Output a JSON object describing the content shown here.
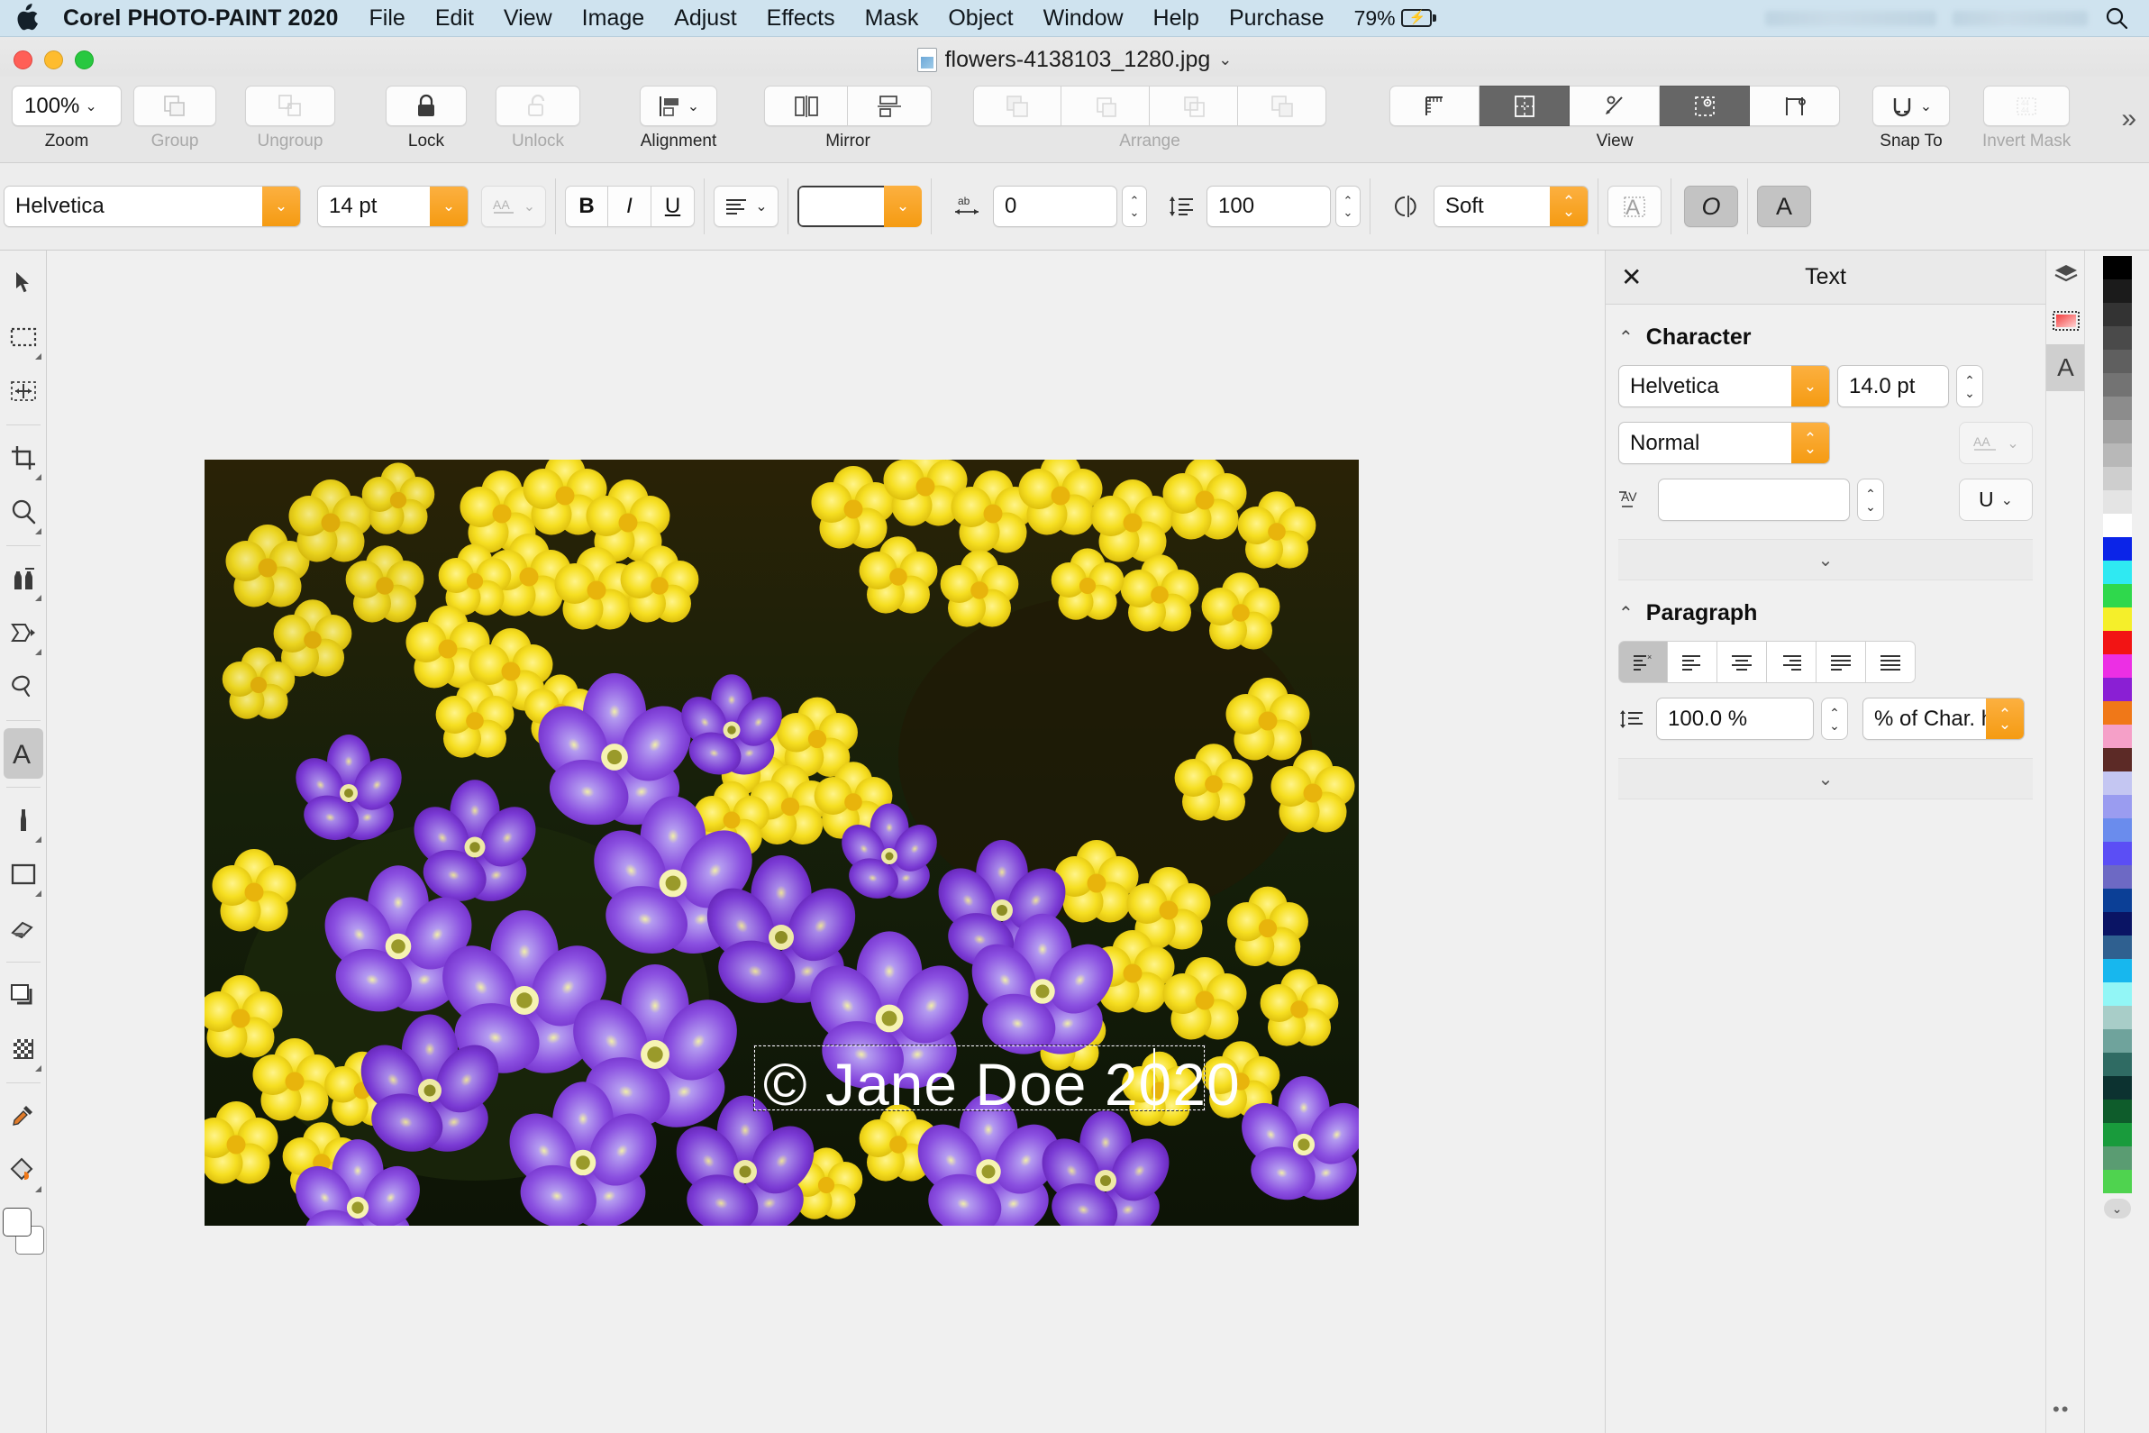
{
  "menubar": {
    "app_name": "Corel PHOTO-PAINT 2020",
    "items": [
      "File",
      "Edit",
      "View",
      "Image",
      "Adjust",
      "Effects",
      "Mask",
      "Object",
      "Window",
      "Help",
      "Purchase"
    ],
    "battery_pct": "79%",
    "battery_icon": "battery-charging-icon",
    "search_icon": "search-icon",
    "apple_icon": "apple-logo-icon"
  },
  "titlebar": {
    "filename": "flowers-4138103_1280.jpg",
    "chevron": "⌄",
    "doc_icon": "jpeg-document-icon"
  },
  "command_toolbar": {
    "zoom": {
      "value": "100%",
      "label": "Zoom",
      "chevron": "⌄"
    },
    "groups": [
      {
        "label": "Group",
        "enabled": false,
        "icon": "group-objects-icon"
      },
      {
        "label": "Ungroup",
        "enabled": false,
        "icon": "ungroup-objects-icon"
      },
      {
        "label": "Lock",
        "enabled": true,
        "icon": "lock-closed-icon"
      },
      {
        "label": "Unlock",
        "enabled": false,
        "icon": "lock-open-icon"
      }
    ],
    "alignment": {
      "label": "Alignment",
      "icon": "align-objects-icon",
      "chevron": "⌄"
    },
    "mirror": {
      "label": "Mirror",
      "icons": [
        "mirror-horizontal-icon",
        "mirror-vertical-icon"
      ]
    },
    "arrange": {
      "label": "Arrange",
      "icons": [
        "bring-to-front-icon",
        "bring-forward-icon",
        "send-backward-icon",
        "send-to-back-icon"
      ],
      "enabled": false
    },
    "view": {
      "label": "View",
      "buttons": [
        {
          "icon": "rulers-icon",
          "active": false
        },
        {
          "icon": "grid-icon",
          "active": true
        },
        {
          "icon": "guidelines-icon",
          "active": false
        },
        {
          "icon": "snap-guides-icon",
          "active": true
        },
        {
          "icon": "dynamic-guides-icon",
          "active": false
        }
      ]
    },
    "snap_to": {
      "label": "Snap To",
      "icon": "magnet-icon",
      "chevron": "⌄"
    },
    "invert_mask": {
      "label": "Invert Mask",
      "icon": "invert-mask-icon",
      "enabled": false
    },
    "overflow": "»"
  },
  "text_toolbar": {
    "font_family": "Helvetica",
    "font_size": "14 pt",
    "case_icon": "change-case-icon",
    "bold": "B",
    "italic": "I",
    "underline": "U",
    "align_icon": "text-align-icon",
    "color_swatch": "#ffffff",
    "tracking_icon": "character-spacing-icon",
    "tracking_value": "0",
    "leading_icon": "line-spacing-icon",
    "leading_value": "100",
    "smoothing_icon": "anti-alias-icon",
    "smoothing_value": "Soft",
    "buttons": [
      {
        "icon": "text-to-mask-icon",
        "pressed": false
      },
      {
        "icon": "wrap-text-icon",
        "pressed": true
      },
      {
        "icon": "text-options-icon",
        "pressed": true
      }
    ]
  },
  "toolbox": {
    "tools": [
      {
        "name": "pick-tool",
        "selected": false,
        "flyout": false
      },
      {
        "name": "rectangle-mask-tool",
        "selected": false,
        "flyout": true
      },
      {
        "name": "mask-transform-tool",
        "selected": false,
        "flyout": false
      },
      {
        "name": "crop-tool",
        "selected": false,
        "flyout": true
      },
      {
        "name": "zoom-tool",
        "selected": false,
        "flyout": true
      },
      {
        "name": "clone-tool",
        "selected": false,
        "flyout": true
      },
      {
        "name": "smear-tool",
        "selected": false,
        "flyout": true
      },
      {
        "name": "sharpen-tool",
        "selected": false,
        "flyout": false
      },
      {
        "name": "text-tool",
        "selected": true,
        "flyout": false
      },
      {
        "name": "paint-tool",
        "selected": false,
        "flyout": true
      },
      {
        "name": "rectangle-shape-tool",
        "selected": false,
        "flyout": true
      },
      {
        "name": "eraser-tool",
        "selected": false,
        "flyout": false
      },
      {
        "name": "object-transparency-tool",
        "selected": false,
        "flyout": false
      },
      {
        "name": "fill-tool",
        "selected": false,
        "flyout": true
      },
      {
        "name": "eyedropper-tool",
        "selected": false,
        "flyout": false
      },
      {
        "name": "interactive-fill-tool",
        "selected": false,
        "flyout": true
      }
    ],
    "foreground_color": "#ffffff",
    "background_color": "#ffffff"
  },
  "canvas": {
    "overlay_text": "© Jane Doe 2020",
    "selection": "text-object-selected"
  },
  "docker": {
    "title": "Text",
    "close_icon": "close-icon",
    "character": {
      "heading": "Character",
      "caret": "⌃",
      "font_family": "Helvetica",
      "font_size": "14.0 pt",
      "font_style": "Normal",
      "case_icon": "change-case-icon",
      "kerning_icon": "kerning-icon",
      "kerning_value": "",
      "underline_label": "U",
      "expand_caret": "⌄"
    },
    "paragraph": {
      "heading": "Paragraph",
      "caret": "⌃",
      "align_buttons": [
        {
          "icon": "align-none-icon",
          "active": true
        },
        {
          "icon": "align-left-icon",
          "active": false
        },
        {
          "icon": "align-center-icon",
          "active": false
        },
        {
          "icon": "align-right-icon",
          "active": false
        },
        {
          "icon": "align-justify-icon",
          "active": false
        },
        {
          "icon": "align-force-justify-icon",
          "active": false
        }
      ],
      "line_spacing_icon": "line-spacing-icon",
      "line_spacing_value": "100.0 %",
      "line_spacing_unit": "% of Char. heig...",
      "expand_caret": "⌄"
    }
  },
  "docker_rail": {
    "buttons": [
      {
        "icon": "objects-docker-icon",
        "active": false
      },
      {
        "icon": "color-docker-icon",
        "active": false
      },
      {
        "icon": "text-docker-icon",
        "active": true
      }
    ]
  },
  "palette": {
    "more_icon": "chevron-down-icon",
    "options_icon": "palette-options-icon",
    "colors": [
      "#000000",
      "#1b1b1b",
      "#333333",
      "#4a4a4a",
      "#5f5f5f",
      "#737373",
      "#8c8c8c",
      "#a3a3a3",
      "#b8b8b8",
      "#cecece",
      "#e4e4e4",
      "#ffffff",
      "#0b24e8",
      "#2fe9f2",
      "#2fd84c",
      "#f5ef2a",
      "#f21414",
      "#ec2fe4",
      "#8a1fd4",
      "#f07818",
      "#f5a0c8",
      "#5c2a26",
      "#c4c6f2",
      "#9a9cf0",
      "#6a8ced",
      "#5b4ef5",
      "#6d69c4",
      "#0b3f96",
      "#0a1464",
      "#2f6090",
      "#17b7ee",
      "#92f6f6",
      "#a8cdc8",
      "#6fa39c",
      "#2f6b63",
      "#0c3230",
      "#0e5c2b",
      "#199b3c",
      "#5a9c72",
      "#4fd34f"
    ]
  }
}
